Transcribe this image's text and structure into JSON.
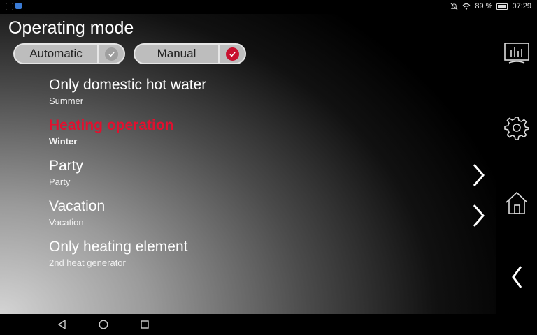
{
  "status": {
    "battery": "89 %",
    "time": "07:29"
  },
  "page": {
    "title": "Operating mode"
  },
  "modes": {
    "automatic": {
      "label": "Automatic",
      "check_color": "#9e9e9e"
    },
    "manual": {
      "label": "Manual",
      "check_color": "#c8102e"
    }
  },
  "items": [
    {
      "title": "Only domestic hot water",
      "subtitle": "Summer"
    },
    {
      "title": "Heating operation",
      "subtitle": "Winter"
    },
    {
      "title": "Party",
      "subtitle": "Party"
    },
    {
      "title": "Vacation",
      "subtitle": "Vacation"
    },
    {
      "title": "Only heating element",
      "subtitle": "2nd heat generator"
    }
  ],
  "colors": {
    "accent": "#e1102f"
  },
  "sidebar_icons": [
    "display-chart-icon",
    "gear-icon",
    "home-icon",
    "chevron-left-icon"
  ],
  "nav_icons": [
    "back-triangle-icon",
    "home-circle-icon",
    "recents-square-icon"
  ]
}
